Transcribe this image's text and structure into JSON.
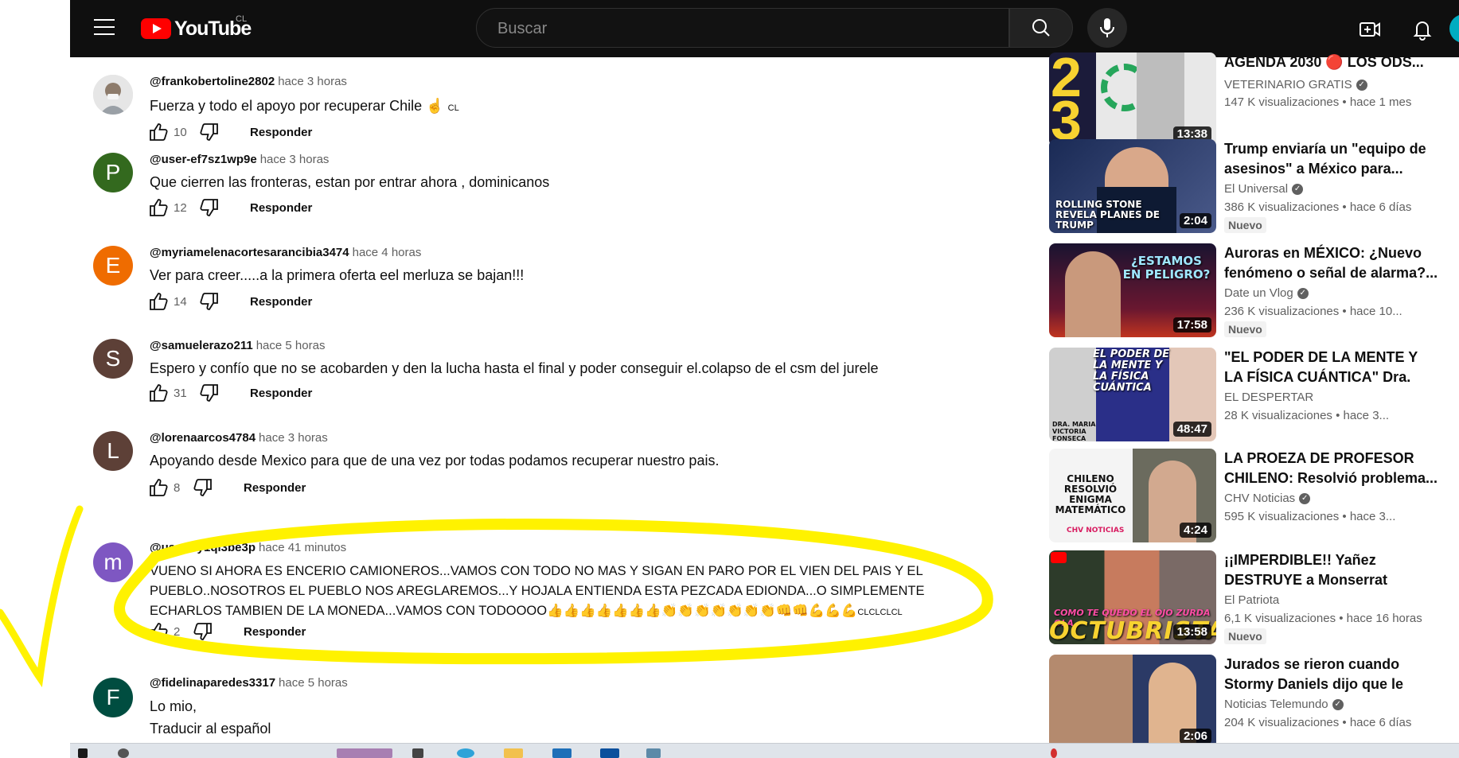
{
  "header": {
    "logo_text": "YouTube",
    "country": "CL",
    "search_placeholder": "Buscar"
  },
  "comments": [
    {
      "author": "@frankobertoline2802",
      "time": "hace 3 horas",
      "text": "Fuerza y todo el apoyo por recuperar Chile ☝️",
      "text_suffix": "CL",
      "likes": "10",
      "reply": "Responder",
      "avatar_letter": "",
      "avatar_color": "#cfcfcf"
    },
    {
      "author": "@user-ef7sz1wp9e",
      "time": "hace 3 horas",
      "text": "Que cierren las fronteras, estan por entrar ahora , dominicanos",
      "likes": "12",
      "reply": "Responder",
      "avatar_letter": "P",
      "avatar_color": "#33691e"
    },
    {
      "author": "@myriamelenacortesarancibia3474",
      "time": "hace 4 horas",
      "text": "Ver para creer.....a la primera oferta eel merluza se bajan!!!",
      "likes": "14",
      "reply": "Responder",
      "avatar_letter": "E",
      "avatar_color": "#ef6c00"
    },
    {
      "author": "@samuelerazo211",
      "time": "hace 5 horas",
      "text": "Espero y confío que no se acobarden y den la lucha hasta el final y poder conseguir el.colapso de el csm del jurele",
      "likes": "31",
      "reply": "Responder",
      "avatar_letter": "S",
      "avatar_color": "#5d4037"
    },
    {
      "author": "@lorenaarcos4784",
      "time": "hace 3 horas",
      "text": "Apoyando desde Mexico para que de una vez por todas podamos recuperar nuestro pais.",
      "likes": "8",
      "reply": "Responder",
      "avatar_letter": "L",
      "avatar_color": "#5d4037"
    },
    {
      "author": "@user-vy1qi3be3p",
      "time": "hace 41 minutos",
      "text_lines": [
        "VUENO SI AHORA ES ENCERIO CAMIONEROS...VAMOS CON TODO NO MAS Y SIGAN EN PARO POR EL VIEN DEL PAIS Y EL",
        "PUEBLO..NOSOTROS EL PUEBLO NOS AREGLAREMOS...Y HOJALA ENTIENDA ESTA PEZCADA EDIONDA...O SIMPLEMENTE",
        "ECHARLOS TAMBIEN DE LA MONEDA...VAMOS CON TODOOOO👍👍👍👍👍👍👍👏👏👏👏👏👏👏👊👊💪💪💪"
      ],
      "text_suffix": "CLCLCLCL",
      "likes": "2",
      "reply": "Responder",
      "avatar_letter": "m",
      "avatar_color": "#7e57c2"
    },
    {
      "author": "@fidelinaparedes3317",
      "time": "hace 5 horas",
      "text": "Lo mio,",
      "translate": "Traducir al español",
      "avatar_letter": "F",
      "avatar_color": "#004d40"
    }
  ],
  "sidebar": [
    {
      "title": "AGENDA 2030 🔴 LOS ODS...",
      "channel": "VETERINARIO GRATIS",
      "verified": true,
      "meta": "147 K visualizaciones • hace 1 mes",
      "duration": "13:38",
      "badge": ""
    },
    {
      "title": "Trump enviaría un \"equipo de asesinos\" a México para...",
      "channel": "El Universal",
      "verified": true,
      "meta": "386 K visualizaciones • hace 6 días",
      "duration": "2:04",
      "badge": "Nuevo",
      "thumb_text": "ROLLING STONE REVELA PLANES DE TRUMP"
    },
    {
      "title": "Auroras en MÉXICO: ¿Nuevo fenómeno o señal de alarma?...",
      "channel": "Date un Vlog",
      "verified": true,
      "meta": "236 K visualizaciones • hace 10...",
      "duration": "17:58",
      "badge": "Nuevo",
      "thumb_text": "¿ESTAMOS EN PELIGRO?"
    },
    {
      "title": "\"EL PODER DE LA MENTE Y LA FÍSICA CUÁNTICA\" Dra. MARI...",
      "channel": "EL DESPERTAR",
      "verified": false,
      "meta": "28 K visualizaciones • hace 3...",
      "duration": "48:47",
      "badge": "",
      "thumb_text": "EL PODER DE LA MENTE Y LA FÍSICA CUÁNTICA",
      "thumb_sub": "DRA. MARIA VICTORIA FONSECA"
    },
    {
      "title": "LA PROEZA DE PROFESOR CHILENO: Resolvió problema...",
      "channel": "CHV Noticias",
      "verified": true,
      "meta": "595 K visualizaciones • hace 3...",
      "duration": "4:24",
      "badge": "",
      "thumb_text": "CHILENO RESOLVIÓ ENIGMA MATEMÁTICO",
      "thumb_sub": "CHV NOTICIAS"
    },
    {
      "title": "¡¡IMPERDIBLE!! Yañez DESTRUYE a Monserrat Álvare...",
      "channel": "El Patriota",
      "verified": false,
      "meta": "6,1 K visualizaciones • hace 16 horas",
      "duration": "13:58",
      "badge": "Nuevo",
      "thumb_text": "COMO TE QUEDO EL OJO ZURDA OLA",
      "thumb_sub": "OCTUBRISTA"
    },
    {
      "title": "Jurados se rieron cuando Stormy Daniels dijo que le dio...",
      "channel": "Noticias Telemundo",
      "verified": true,
      "meta": "204 K visualizaciones • hace 6 días",
      "duration": "2:06",
      "badge": ""
    }
  ],
  "colors": {
    "header_bg": "#0f0f0f",
    "brand_red": "#ff0000",
    "highlight": "#fff200"
  }
}
